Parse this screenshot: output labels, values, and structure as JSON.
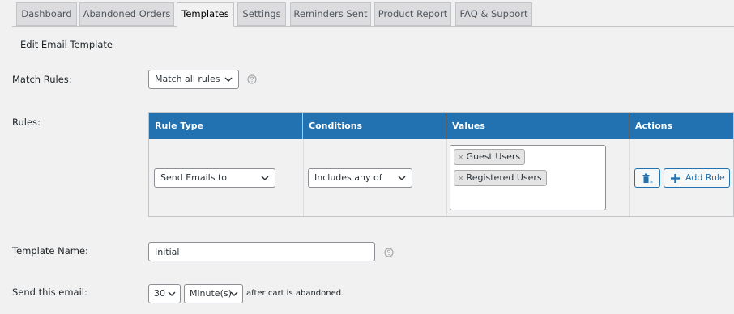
{
  "tabs": [
    {
      "label": "Dashboard",
      "active": false
    },
    {
      "label": "Abandoned Orders",
      "active": false
    },
    {
      "label": "Templates",
      "active": true
    },
    {
      "label": "Settings",
      "active": false
    },
    {
      "label": "Reminders Sent",
      "active": false
    },
    {
      "label": "Product Report",
      "active": false
    },
    {
      "label": "FAQ & Support",
      "active": false
    }
  ],
  "section_title": "Edit Email Template",
  "match_rules": {
    "label": "Match Rules:",
    "value": "Match all rules"
  },
  "rules": {
    "label": "Rules:",
    "headers": [
      "Rule Type",
      "Conditions",
      "Values",
      "Actions"
    ],
    "row": {
      "rule_type": "Send Emails to",
      "condition": "Includes any of",
      "values": [
        "Guest Users",
        "Registered Users"
      ],
      "remove_symbol": "×",
      "add_rule_label": "Add Rule"
    }
  },
  "template_name": {
    "label": "Template Name:",
    "value": "Initial"
  },
  "send_email": {
    "label": "Send this email:",
    "amount": "30",
    "unit": "Minute(s)",
    "suffix": "after cart is abandoned."
  },
  "icons": {
    "help": "question-circle-icon",
    "dropdown": "chevron-down-icon",
    "delete": "trash-icon",
    "add": "plus-icon"
  },
  "colors": {
    "header": "#2271b1",
    "accent": "#2271b1",
    "background": "#f1f1f1"
  }
}
